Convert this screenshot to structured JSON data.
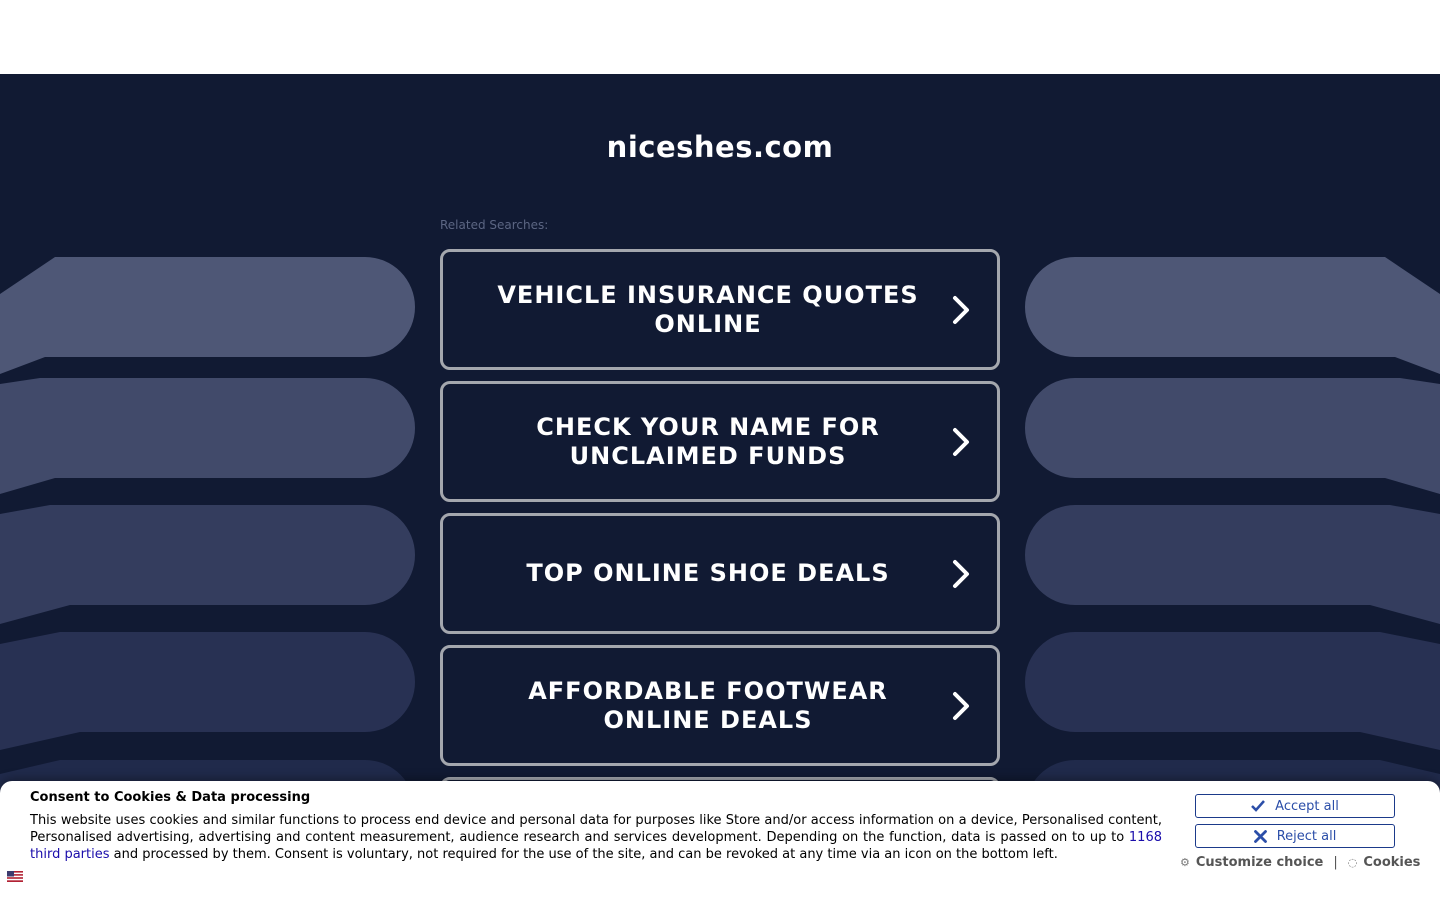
{
  "site": {
    "domain": "niceshes.com",
    "related_label": "Related Searches:"
  },
  "links": [
    {
      "label": "VEHICLE INSURANCE QUOTES ONLINE"
    },
    {
      "label": "CHECK YOUR NAME FOR UNCLAIMED FUNDS"
    },
    {
      "label": "TOP ONLINE SHOE DEALS"
    },
    {
      "label": "AFFORDABLE FOOTWEAR ONLINE DEALS"
    }
  ],
  "icons": {
    "chevron": "chevron-right-icon",
    "accept": "check-icon",
    "reject": "x-icon",
    "customize": "gear-icon",
    "cookies": "cookie-icon",
    "language": "us-flag-icon"
  },
  "consent": {
    "title": "Consent to Cookies & Data processing",
    "text_before_link": "This website uses cookies and similar functions to process end device and personal data for purposes like Store and/or access information on a device, Personalised content, Personalised advertising, advertising and content measurement, audience research and services development. Depending on the function, data is passed on to up to ",
    "link_text": "1168 third parties",
    "text_after_link": " and processed by them. Consent is voluntary, not required for the use of the site, and can be revoked at any time via an icon on the bottom left.",
    "accept_label": "Accept all",
    "reject_label": "Reject all",
    "customize_label": "Customize choice",
    "separator": "|",
    "cookies_label": "Cookies"
  },
  "colors": {
    "background": "#111a33",
    "button_border": "#a4a7ae",
    "deco_light": "#4f5877",
    "deco_dark": "#1d2748",
    "accent": "#2b4ea8"
  }
}
